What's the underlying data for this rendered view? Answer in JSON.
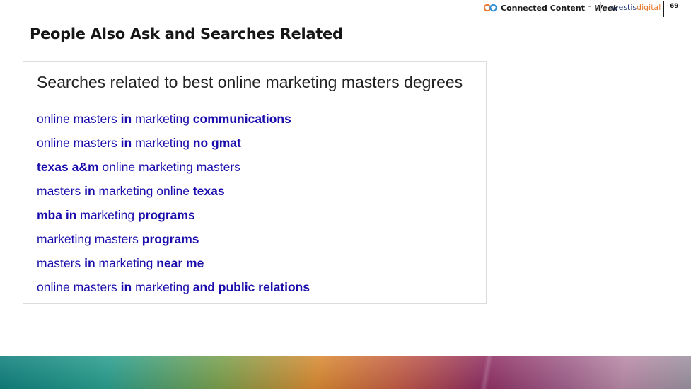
{
  "header": {
    "brand_name": "Connected Content",
    "brand_tm": "™",
    "brand_week": "Week",
    "partner_prefix": "investis",
    "partner_suffix": "digital",
    "page_number": "69"
  },
  "slide": {
    "title": "People Also Ask and Searches Related"
  },
  "search_related": {
    "heading": "Searches related to best online marketing masters degrees",
    "items": [
      {
        "parts": [
          {
            "t": "online masters ",
            "b": false
          },
          {
            "t": "in",
            "b": true
          },
          {
            "t": " marketing ",
            "b": false
          },
          {
            "t": "communications",
            "b": true
          }
        ]
      },
      {
        "parts": [
          {
            "t": "online masters ",
            "b": false
          },
          {
            "t": "in",
            "b": true
          },
          {
            "t": " marketing ",
            "b": false
          },
          {
            "t": "no gmat",
            "b": true
          }
        ]
      },
      {
        "parts": [
          {
            "t": "texas a&m",
            "b": true
          },
          {
            "t": " online marketing masters",
            "b": false
          }
        ]
      },
      {
        "parts": [
          {
            "t": "masters ",
            "b": false
          },
          {
            "t": "in",
            "b": true
          },
          {
            "t": " marketing online ",
            "b": false
          },
          {
            "t": "texas",
            "b": true
          }
        ]
      },
      {
        "parts": [
          {
            "t": "mba in",
            "b": true
          },
          {
            "t": " marketing ",
            "b": false
          },
          {
            "t": "programs",
            "b": true
          }
        ]
      },
      {
        "parts": [
          {
            "t": "marketing masters ",
            "b": false
          },
          {
            "t": "programs",
            "b": true
          }
        ]
      },
      {
        "parts": [
          {
            "t": "masters ",
            "b": false
          },
          {
            "t": "in",
            "b": true
          },
          {
            "t": " marketing ",
            "b": false
          },
          {
            "t": "near me",
            "b": true
          }
        ]
      },
      {
        "parts": [
          {
            "t": "online masters ",
            "b": false
          },
          {
            "t": "in",
            "b": true
          },
          {
            "t": " marketing ",
            "b": false
          },
          {
            "t": "and public relations",
            "b": true
          }
        ]
      }
    ]
  },
  "colors": {
    "link": "#1a0dab",
    "accent_orange": "#e8762c",
    "partner_blue": "#243a7a"
  }
}
